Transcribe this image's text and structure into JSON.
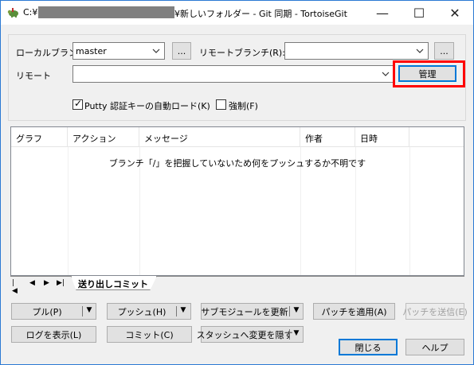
{
  "window": {
    "title_prefix": "C:¥",
    "title_rest": "¥新しいフォルダー - Git 同期 - TortoiseGit",
    "min_glyph": "—",
    "max_glyph": "☐",
    "close_glyph": "✕"
  },
  "sync": {
    "local_branch_label": "ローカルブランチ",
    "local_branch_value": "master",
    "browse_label": "...",
    "remote_branch_label": "リモートブランチ(R):",
    "remote_branch_value": "",
    "remote_label": "リモート",
    "remote_value": "",
    "manage_label": "管理",
    "putty_label": "Putty 認証キーの自動ロード(K)",
    "putty_checked": true,
    "force_label": "強制(F)",
    "force_checked": false
  },
  "log": {
    "columns": [
      "グラフ",
      "アクション",
      "メッセージ",
      "作者",
      "日時"
    ],
    "empty_message": "ブランチ「/」を把握していないため何をプッシュするか不明です",
    "nav": [
      "|◀",
      "◀",
      "▶",
      "▶|"
    ],
    "tab_label": "送り出しコミット"
  },
  "buttons": {
    "pull": "プル(P)",
    "push": "プッシュ(H)",
    "submodule": "サブモジュールを更新",
    "apply_patch": "パッチを適用(A)",
    "send_patch": "パッチを送信(E)",
    "show_log": "ログを表示(L)",
    "commit": "コミット(C)",
    "stash": "スタッシュへ変更を隠す",
    "close": "閉じる",
    "help": "ヘルプ"
  }
}
